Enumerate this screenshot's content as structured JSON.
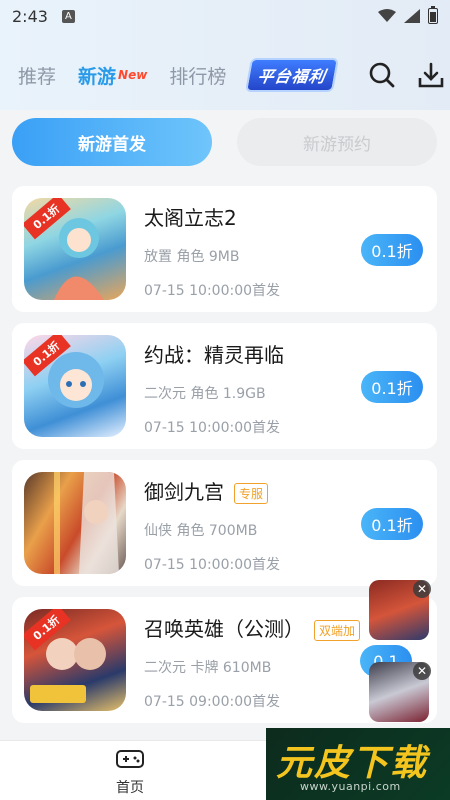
{
  "status_bar": {
    "time": "2:43",
    "notif_icon": "A"
  },
  "header": {
    "tabs": [
      {
        "label": "推荐"
      },
      {
        "label": "新游",
        "badge": "New"
      },
      {
        "label": "排行榜"
      }
    ],
    "welfare_label": "平台福利",
    "icons": [
      "search-icon",
      "download-icon"
    ]
  },
  "sub_tabs": [
    {
      "label": "新游首发",
      "active": true
    },
    {
      "label": "新游预约",
      "active": false
    }
  ],
  "games": [
    {
      "title": "太阁立志2",
      "tag": "",
      "meta": "放置 角色 9MB",
      "date": "07-15 10:00:00首发",
      "discount": "0.1折",
      "badge": "0.1折"
    },
    {
      "title": "约战：精灵再临",
      "tag": "",
      "meta": "二次元 角色 1.9GB",
      "date": "07-15 10:00:00首发",
      "discount": "0.1折",
      "badge": "0.1折"
    },
    {
      "title": "御剑九宫",
      "tag": "专服",
      "meta": "仙侠 角色 700MB",
      "date": "07-15 10:00:00首发",
      "discount": "0.1折",
      "badge": ""
    },
    {
      "title": "召唤英雄（公测）",
      "tag": "双端加",
      "meta": "二次元 卡牌 610MB",
      "date": "07-15 09:00:00首发",
      "discount": "0.1",
      "badge": "0.1折"
    }
  ],
  "bottom_nav": {
    "home_label": "首页"
  },
  "watermark": {
    "title": "元皮下载",
    "url": "www.yuanpi.com"
  },
  "colors": {
    "accent": "#2a9be8",
    "discount_start": "#4ab5f8",
    "discount_end": "#2b8ff0",
    "tag": "#f0a22a"
  }
}
